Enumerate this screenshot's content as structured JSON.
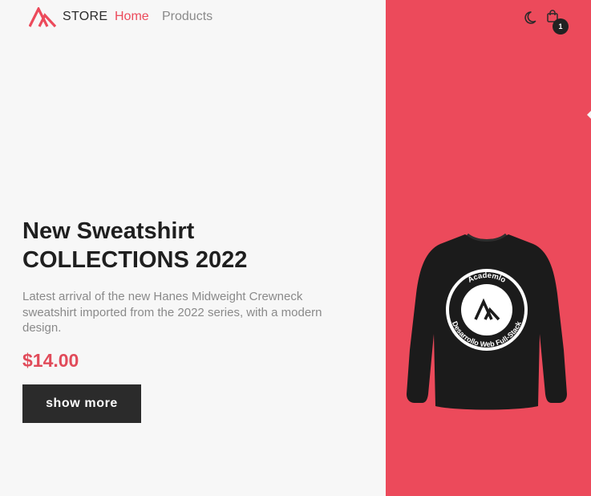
{
  "header": {
    "brand": "STORE",
    "nav": {
      "home": "Home",
      "products": "Products"
    },
    "cart_count": "1",
    "icons": {
      "theme": "moon-icon",
      "cart": "shopping-bag-icon"
    }
  },
  "hero": {
    "title_line1": "New Sweatshirt",
    "title_line2": "COLLECTIONS 2022",
    "description": "Latest arrival of the new Hanes Midweight Crewneck sweatshirt imported from the 2022 series, with a modern design.",
    "price": "$14.00",
    "button": "show more"
  },
  "product": {
    "badge_top": "Academlo",
    "badge_bottom": "Desarrollo Web Full-Stack"
  },
  "colors": {
    "accent": "#ec4a5b",
    "dark": "#2b2b2b",
    "background": "#f7f7f7"
  }
}
